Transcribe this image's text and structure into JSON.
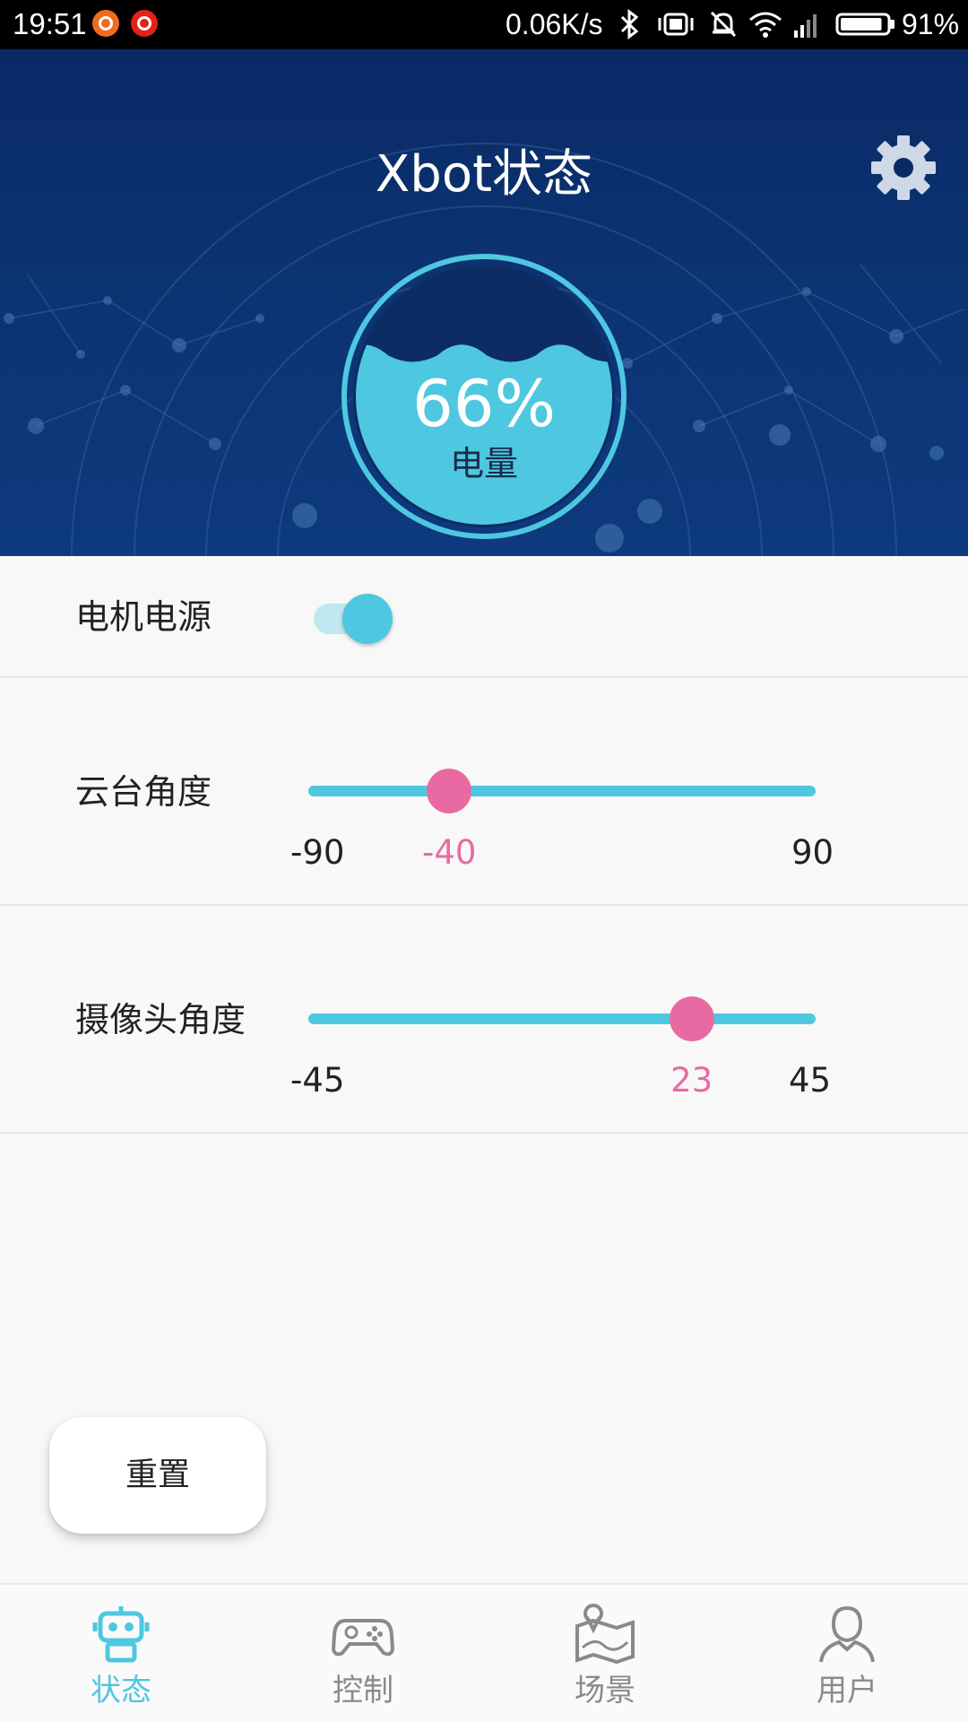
{
  "status_bar": {
    "time": "19:51",
    "network_speed": "0.06K/s",
    "battery_percent": "91%",
    "battery_level": 0.91,
    "icons": [
      "mi-app-icon",
      "netease-music-icon",
      "bluetooth-icon",
      "vibrate-icon",
      "mute-icon",
      "wifi-icon",
      "signal-icon",
      "battery-icon"
    ]
  },
  "header": {
    "title": "Xbot状态",
    "settings_icon": "gear-icon",
    "battery": {
      "percent_text": "66%",
      "level": 0.66,
      "label": "电量"
    }
  },
  "controls": {
    "motor_power": {
      "label": "电机电源",
      "enabled": true
    },
    "gimbal_angle": {
      "label": "云台角度",
      "min": "-90",
      "max": "90",
      "value": "-40",
      "min_value": -90,
      "max_value": 90,
      "current": -40
    },
    "camera_angle": {
      "label": "摄像头角度",
      "min": "-45",
      "max": "45",
      "value": "23",
      "min_value": -45,
      "max_value": 45,
      "current": 23
    }
  },
  "reset_button": {
    "label": "重置"
  },
  "bottom_nav": {
    "items": [
      {
        "label": "状态",
        "icon": "robot-icon",
        "active": true
      },
      {
        "label": "控制",
        "icon": "gamepad-icon",
        "active": false
      },
      {
        "label": "场景",
        "icon": "map-icon",
        "active": false
      },
      {
        "label": "用户",
        "icon": "user-icon",
        "active": false
      }
    ]
  },
  "colors": {
    "accent": "#4ec7e0",
    "slider_thumb": "#e96aa2",
    "header_bg": "#0c3372"
  }
}
